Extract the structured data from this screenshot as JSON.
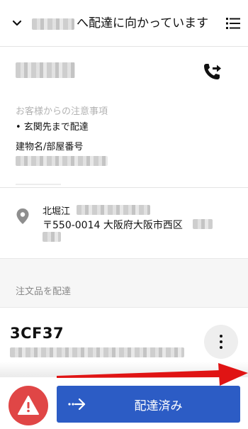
{
  "header": {
    "title": "へ配達に向かっています"
  },
  "notes": {
    "heading": "お客様からの注意事項",
    "item": "•  玄関先まで配達",
    "building_label": "建物名/部屋番号"
  },
  "address": {
    "line1": "北堀江",
    "line2": "〒550-0014 大阪府大阪市西区"
  },
  "section": {
    "label": "注文品を配達"
  },
  "order": {
    "code": "3CF37"
  },
  "actions": {
    "deliver_label": "配達済み"
  },
  "colors": {
    "primary_button": "#2c5cc5",
    "alert_button": "#e04646",
    "annotation_arrow": "#e01414"
  }
}
